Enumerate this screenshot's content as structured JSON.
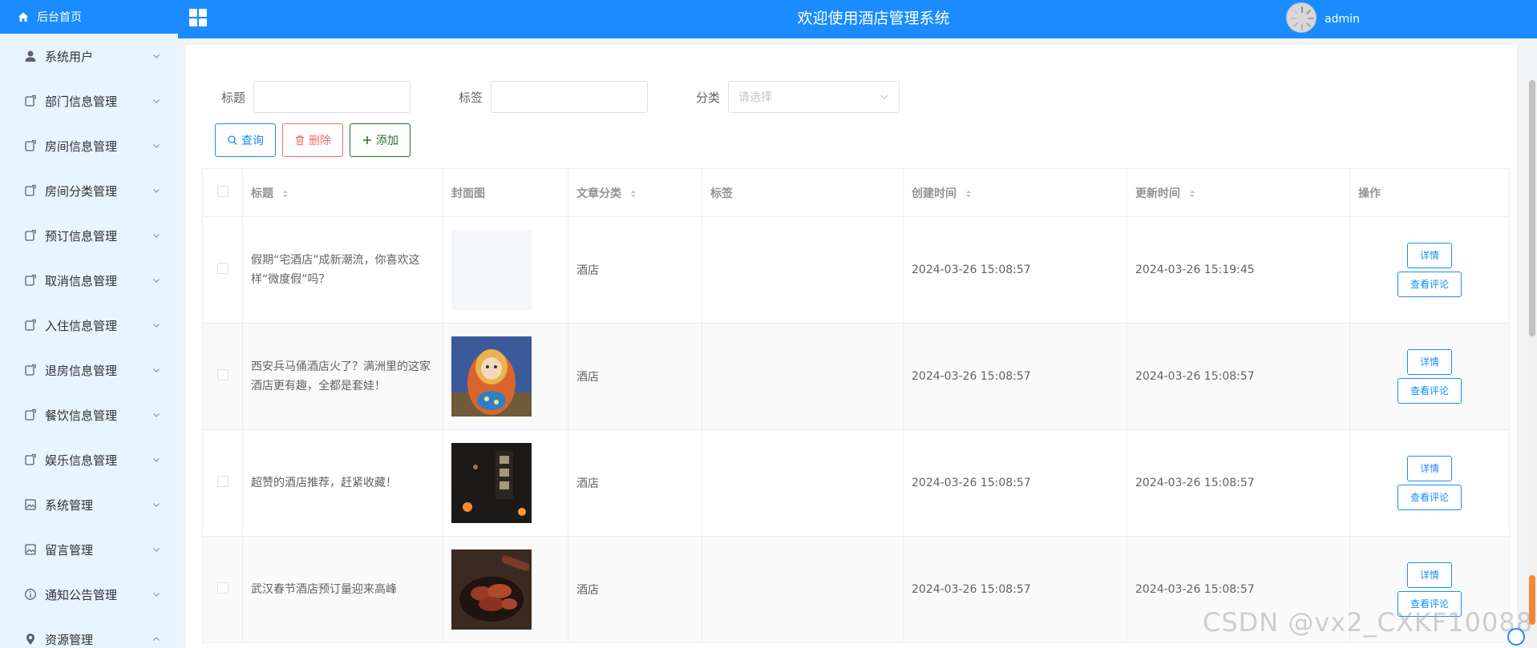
{
  "sidebar": {
    "home_label": "后台首页",
    "items": [
      {
        "label": "系统用户",
        "icon": "user-icon"
      },
      {
        "label": "部门信息管理",
        "icon": "document-icon"
      },
      {
        "label": "房间信息管理",
        "icon": "document-icon"
      },
      {
        "label": "房间分类管理",
        "icon": "document-icon"
      },
      {
        "label": "预订信息管理",
        "icon": "document-icon"
      },
      {
        "label": "取消信息管理",
        "icon": "document-icon"
      },
      {
        "label": "入住信息管理",
        "icon": "document-icon"
      },
      {
        "label": "退房信息管理",
        "icon": "document-icon"
      },
      {
        "label": "餐饮信息管理",
        "icon": "document-icon"
      },
      {
        "label": "娱乐信息管理",
        "icon": "document-icon"
      },
      {
        "label": "系统管理",
        "icon": "picture-icon"
      },
      {
        "label": "留言管理",
        "icon": "picture-icon"
      },
      {
        "label": "通知公告管理",
        "icon": "info-icon"
      },
      {
        "label": "资源管理",
        "icon": "location-icon"
      }
    ]
  },
  "header": {
    "title": "欢迎使用酒店管理系统",
    "username": "admin"
  },
  "search": {
    "title_label": "标题",
    "tag_label": "标签",
    "category_label": "分类",
    "category_placeholder": "请选择",
    "title_value": "",
    "tag_value": ""
  },
  "actions": {
    "query": "查询",
    "delete": "删除",
    "add": "添加"
  },
  "table": {
    "headers": {
      "title": "标题",
      "cover": "封面图",
      "category": "文章分类",
      "tags": "标签",
      "created": "创建时间",
      "updated": "更新时间",
      "ops": "操作"
    },
    "detail_label": "详情",
    "comments_label": "查看评论",
    "rows": [
      {
        "title": "假期“宅酒店”成新潮流，你喜欢这样“微度假”吗？",
        "category": "酒店",
        "tags": "",
        "created": "2024-03-26 15:08:57",
        "updated": "2024-03-26 15:19:45"
      },
      {
        "title": "西安兵马俑酒店火了？满洲里的这家酒店更有趣，全都是套娃！",
        "category": "酒店",
        "tags": "",
        "created": "2024-03-26 15:08:57",
        "updated": "2024-03-26 15:08:57"
      },
      {
        "title": "超赞的酒店推荐，赶紧收藏！",
        "category": "酒店",
        "tags": "",
        "created": "2024-03-26 15:08:57",
        "updated": "2024-03-26 15:08:57"
      },
      {
        "title": "武汉春节酒店预订量迎来高峰",
        "category": "酒店",
        "tags": "",
        "created": "2024-03-26 15:08:57",
        "updated": "2024-03-26 15:08:57"
      }
    ]
  },
  "watermark": "CSDN @vx2_CXKF10088",
  "colors": {
    "brand": "#1a8cff",
    "sidebar_bg": "#e8f4ff",
    "delete": "#f56c6c",
    "add": "#2d6a2d"
  }
}
